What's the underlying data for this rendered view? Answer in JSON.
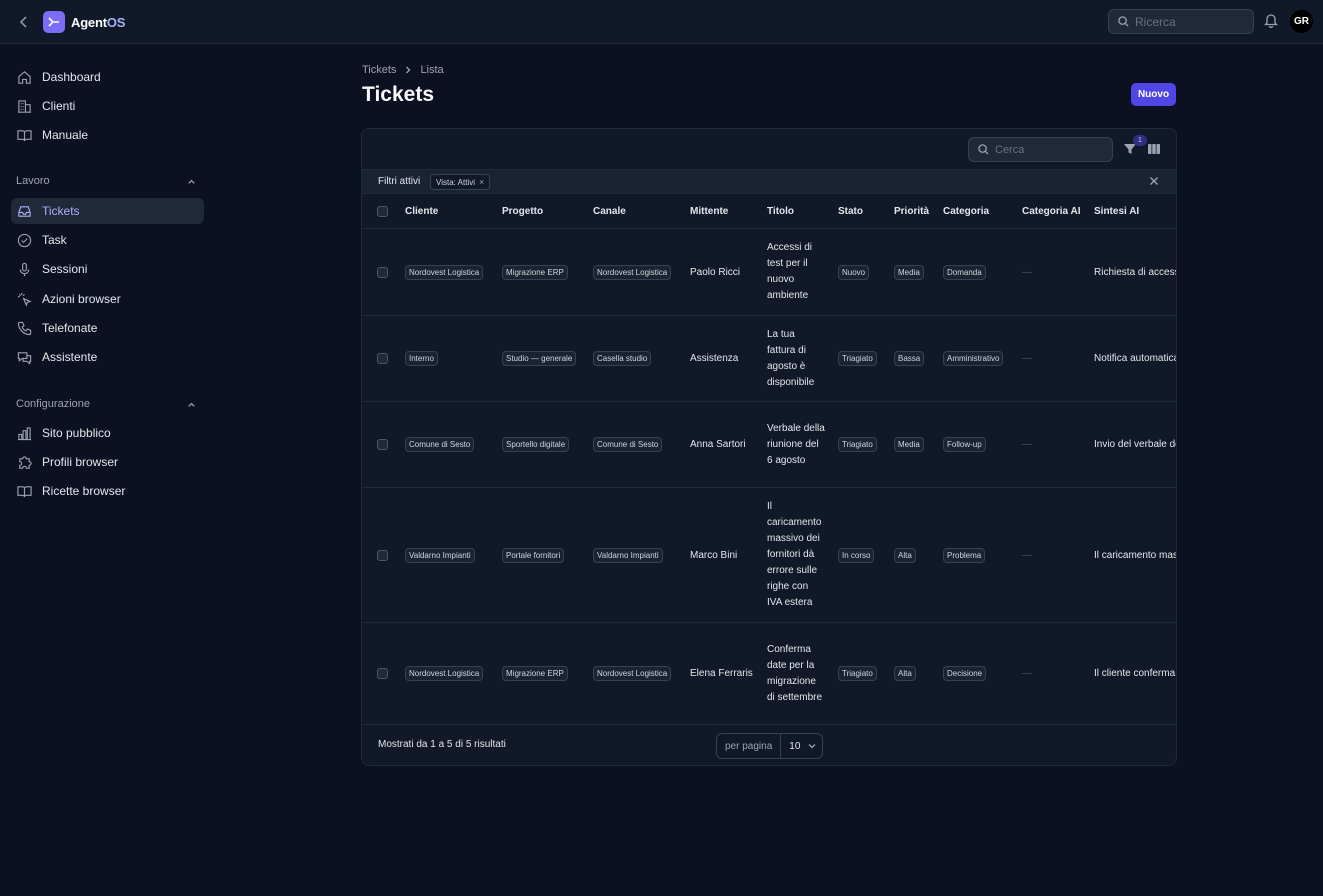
{
  "app": {
    "brand_a": "Agent",
    "brand_b": "OS"
  },
  "topbar": {
    "search_placeholder": "Ricerca",
    "avatar_initials": "GR"
  },
  "sidebar": {
    "main": [
      {
        "label": "Dashboard",
        "icon": "home-icon"
      },
      {
        "label": "Clienti",
        "icon": "building-icon"
      },
      {
        "label": "Manuale",
        "icon": "book-icon"
      }
    ],
    "section_work": "Lavoro",
    "work": [
      {
        "label": "Tickets",
        "icon": "inbox-icon",
        "active": true
      },
      {
        "label": "Task",
        "icon": "check-circle-icon"
      },
      {
        "label": "Sessioni",
        "icon": "microphone-icon"
      },
      {
        "label": "Azioni browser",
        "icon": "cursor-click-icon"
      },
      {
        "label": "Telefonate",
        "icon": "phone-icon"
      },
      {
        "label": "Assistente",
        "icon": "chat-icon"
      }
    ],
    "section_config": "Configurazione",
    "config": [
      {
        "label": "Sito pubblico",
        "icon": "bar-chart-icon"
      },
      {
        "label": "Profili browser",
        "icon": "puzzle-icon"
      },
      {
        "label": "Ricette browser",
        "icon": "book-open-icon"
      }
    ]
  },
  "breadcrumb": {
    "root": "Tickets",
    "current": "Lista"
  },
  "page": {
    "title": "Tickets",
    "new_button": "Nuovo"
  },
  "table": {
    "search_placeholder": "Cerca",
    "filter_count": "1",
    "filters_label": "Filtri attivi",
    "filter_chip": "Vista: Attivi",
    "filter_chip_remove": "×",
    "columns": [
      "Cliente",
      "Progetto",
      "Canale",
      "Mittente",
      "Titolo",
      "Stato",
      "Priorità",
      "Categoria",
      "Categoria AI",
      "Sintesi AI"
    ],
    "rows": [
      {
        "cliente": "Nordovest Logistica",
        "progetto": "Migrazione ERP",
        "canale": "Nordovest Logistica",
        "mittente": "Paolo Ricci",
        "titolo": "Accessi di test per il nuovo ambiente",
        "stato": "Nuovo",
        "priorita": "Media",
        "categoria": "Domanda",
        "categoria_ai": "—",
        "sintesi": "Richiesta di accesso"
      },
      {
        "cliente": "Interno",
        "progetto": "Studio — generale",
        "canale": "Casella studio",
        "mittente": "Assistenza",
        "titolo": "La tua fattura di agosto è disponibile",
        "stato": "Triagiato",
        "priorita": "Bassa",
        "categoria": "Amministrativo",
        "categoria_ai": "—",
        "sintesi": "Notifica automatica"
      },
      {
        "cliente": "Comune di Sesto",
        "progetto": "Sportello digitale",
        "canale": "Comune di Sesto",
        "mittente": "Anna Sartori",
        "titolo": "Verbale della riunione del 6 agosto",
        "stato": "Triagiato",
        "priorita": "Media",
        "categoria": "Follow-up",
        "categoria_ai": "—",
        "sintesi": "Invio del verbale de"
      },
      {
        "cliente": "Valdarno Impianti",
        "progetto": "Portale fornitori",
        "canale": "Valdarno Impianti",
        "mittente": "Marco Bini",
        "titolo": "Il caricamento massivo dei fornitori dà errore sulle righe con IVA estera",
        "stato": "In corso",
        "priorita": "Alta",
        "categoria": "Problema",
        "categoria_ai": "—",
        "sintesi": "Il caricamento mas"
      },
      {
        "cliente": "Nordovest Logistica",
        "progetto": "Migrazione ERP",
        "canale": "Nordovest Logistica",
        "mittente": "Elena Ferraris",
        "titolo": "Conferma date per la migrazione di settembre",
        "stato": "Triagiato",
        "priorita": "Alta",
        "categoria": "Decisione",
        "categoria_ai": "—",
        "sintesi": "Il cliente conferma"
      }
    ],
    "results_text": "Mostrati da 1 a 5 di 5 risultati",
    "per_page_label": "per pagina",
    "per_page_value": "10"
  }
}
